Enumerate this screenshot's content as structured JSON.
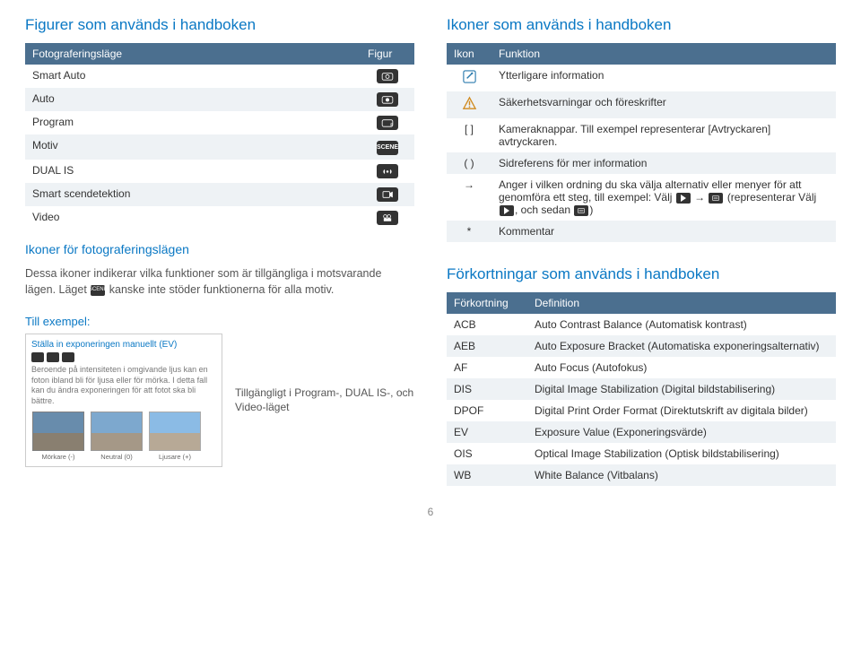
{
  "left": {
    "heading": "Figurer som används i handboken",
    "table": {
      "h1": "Fotograferingsläge",
      "h2": "Figur",
      "rows": [
        {
          "mode": "Smart Auto",
          "icon": "smart-auto-icon"
        },
        {
          "mode": "Auto",
          "icon": "auto-icon"
        },
        {
          "mode": "Program",
          "icon": "program-icon"
        },
        {
          "mode": "Motiv",
          "icon": "scene-icon"
        },
        {
          "mode": "DUAL IS",
          "icon": "dual-is-icon"
        },
        {
          "mode": "Smart scendetektion",
          "icon": "smart-scene-icon"
        },
        {
          "mode": "Video",
          "icon": "video-icon"
        }
      ]
    },
    "sub1": "Ikoner för fotograferingslägen",
    "para": "Dessa ikoner indikerar vilka funktioner som är tillgängliga i motsvarande lägen. Läget     kanske inte stöder funktionerna för alla motiv.",
    "para_before": "Dessa ikoner indikerar vilka funktioner som är tillgängliga i motsvarande lägen. Läget",
    "para_after": "kanske inte stöder funktionerna för alla motiv.",
    "example_label": "Till exempel:",
    "example": {
      "title": "Ställa in exponeringen manuellt (EV)",
      "body": "Beroende på intensiteten i omgivande ljus kan en foton ibland bli för ljusa eller för mörka. I detta fall kan du ändra exponeringen för att fotot ska bli bättre.",
      "caps": [
        "Mörkare (-)",
        "Neutral (0)",
        "Ljusare (+)"
      ]
    },
    "example_note": "Tillgängligt i Program-, DUAL IS-, och Video-läget"
  },
  "right": {
    "heading": "Ikoner som används i handboken",
    "table1": {
      "h1": "Ikon",
      "h2": "Funktion",
      "rows": [
        {
          "icon": "note-icon",
          "txt": "Ytterligare information"
        },
        {
          "icon": "warn-icon",
          "txt": "Säkerhetsvarningar och föreskrifter"
        },
        {
          "icon": "[ ]",
          "txt": "Kameraknappar. Till exempel representerar [Avtryckaren] avtryckaren."
        },
        {
          "icon": "( )",
          "txt": "Sidreferens för mer information"
        },
        {
          "icon": "→",
          "txt_before": "Anger i vilken ordning du ska välja alternativ eller menyer för att genomföra ett steg, till exempel: Välj",
          "txt_mid": "(representerar Välj",
          "txt_after": ", och sedan",
          "txt_end": ")"
        },
        {
          "icon": "*",
          "txt": "Kommentar"
        }
      ]
    },
    "heading2": "Förkortningar som används i handboken",
    "table2": {
      "h1": "Förkortning",
      "h2": "Definition",
      "rows": [
        {
          "a": "ACB",
          "d": "Auto Contrast Balance (Automatisk kontrast)"
        },
        {
          "a": "AEB",
          "d": "Auto Exposure Bracket (Automatiska exponeringsalternativ)"
        },
        {
          "a": "AF",
          "d": "Auto Focus (Autofokus)"
        },
        {
          "a": "DIS",
          "d": "Digital Image Stabilization (Digital bildstabilisering)"
        },
        {
          "a": "DPOF",
          "d": "Digital Print Order Format (Direktutskrift av digitala bilder)"
        },
        {
          "a": "EV",
          "d": "Exposure Value (Exponeringsvärde)"
        },
        {
          "a": "OIS",
          "d": "Optical Image Stabilization (Optisk bildstabilisering)"
        },
        {
          "a": "WB",
          "d": "White Balance (Vitbalans)"
        }
      ]
    }
  },
  "page": "6"
}
